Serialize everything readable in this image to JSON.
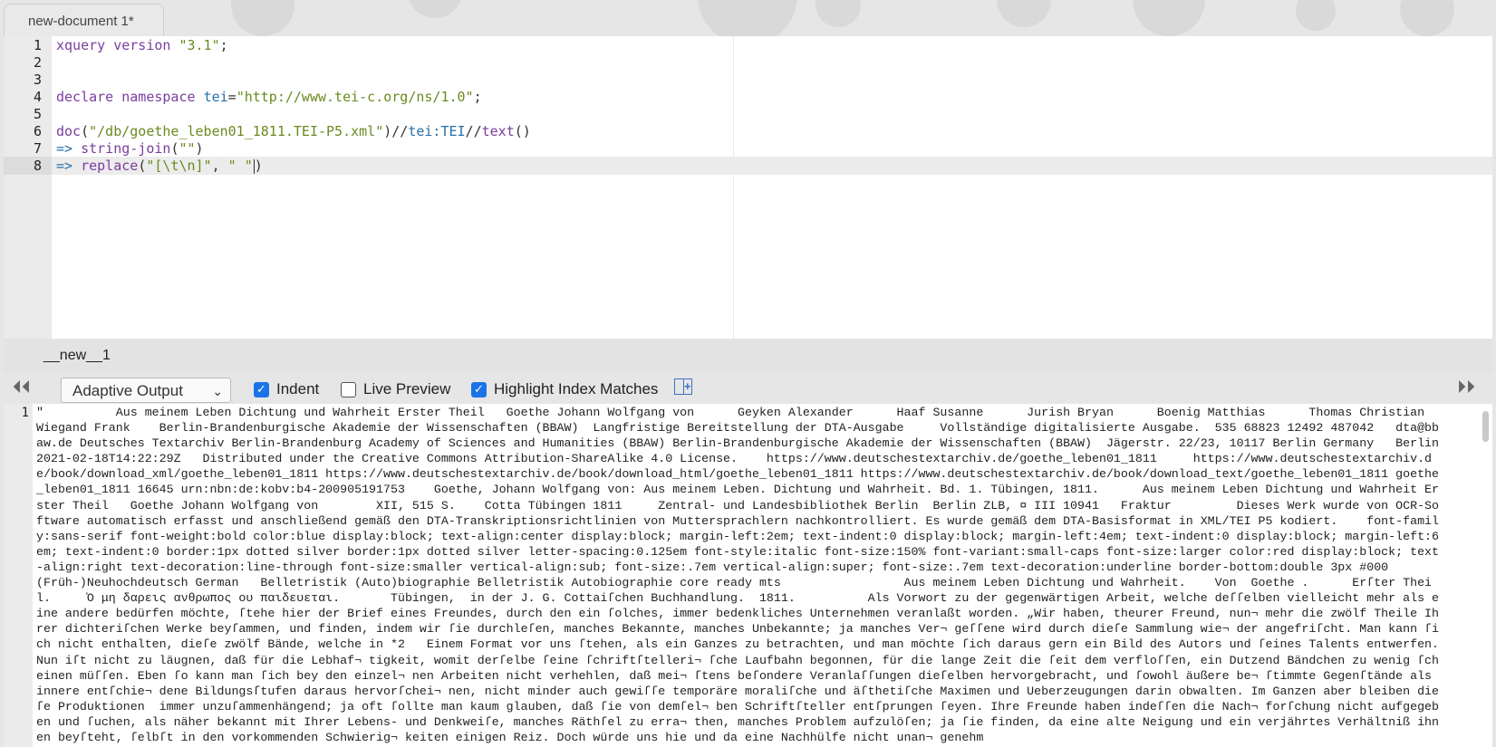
{
  "tab": {
    "title": "new-document 1*"
  },
  "editor": {
    "lines": [
      {
        "n": "1",
        "segments": [
          {
            "t": "xquery version ",
            "c": "kw"
          },
          {
            "t": "\"3.1\"",
            "c": "str"
          },
          {
            "t": ";",
            "c": ""
          }
        ]
      },
      {
        "n": "2",
        "segments": []
      },
      {
        "n": "3",
        "segments": []
      },
      {
        "n": "4",
        "segments": [
          {
            "t": "declare namespace ",
            "c": "kw"
          },
          {
            "t": "tei",
            "c": "ns"
          },
          {
            "t": "=",
            "c": ""
          },
          {
            "t": "\"http://www.tei-c.org/ns/1.0\"",
            "c": "str"
          },
          {
            "t": ";",
            "c": ""
          }
        ]
      },
      {
        "n": "5",
        "segments": []
      },
      {
        "n": "6",
        "segments": [
          {
            "t": "doc",
            "c": "fn"
          },
          {
            "t": "(",
            "c": ""
          },
          {
            "t": "\"/db/goethe_leben01_1811.TEI-P5.xml\"",
            "c": "str"
          },
          {
            "t": ")//",
            "c": ""
          },
          {
            "t": "tei:TEI",
            "c": "ns"
          },
          {
            "t": "//",
            "c": ""
          },
          {
            "t": "text",
            "c": "fn"
          },
          {
            "t": "()",
            "c": ""
          }
        ]
      },
      {
        "n": "7",
        "segments": [
          {
            "t": "=> ",
            "c": "op"
          },
          {
            "t": "string-join",
            "c": "fn"
          },
          {
            "t": "(",
            "c": ""
          },
          {
            "t": "\"\"",
            "c": "str"
          },
          {
            "t": ")",
            "c": ""
          }
        ]
      },
      {
        "n": "8",
        "segments": [
          {
            "t": "=> ",
            "c": "op"
          },
          {
            "t": "replace",
            "c": "fn"
          },
          {
            "t": "(",
            "c": ""
          },
          {
            "t": "\"[\\t\\n]\"",
            "c": "str"
          },
          {
            "t": ", ",
            "c": ""
          },
          {
            "t": "\" \"",
            "c": "str"
          },
          {
            "t": ")",
            "c": ""
          }
        ],
        "active": true
      }
    ]
  },
  "status": {
    "document_name": "__new__1"
  },
  "toolbar": {
    "output_mode": "Adaptive Output",
    "indent_label": "Indent",
    "live_preview_label": "Live Preview",
    "highlight_label": "Highlight Index Matches",
    "indent_checked": true,
    "live_preview_checked": false,
    "highlight_checked": true
  },
  "output": {
    "line_number": "1",
    "text": "\"          Aus meinem Leben Dichtung und Wahrheit Erster Theil   Goethe Johann Wolfgang von      Geyken Alexander      Haaf Susanne      Jurish Bryan      Boenig Matthias      Thomas Christian      Wiegand Frank    Berlin-Brandenburgische Akademie der Wissenschaften (BBAW)  Langfristige Bereitstellung der DTA-Ausgabe     Vollständige digitalisierte Ausgabe.  535 68823 12492 487042   dta@bbaw.de Deutsches Textarchiv Berlin-Brandenburg Academy of Sciences and Humanities (BBAW) Berlin-Brandenburgische Akademie der Wissenschaften (BBAW)  Jägerstr. 22/23, 10117 Berlin Germany   Berlin 2021-02-18T14:22:29Z   Distributed under the Creative Commons Attribution-ShareAlike 4.0 License.    https://www.deutschestextarchiv.de/goethe_leben01_1811     https://www.deutschestextarchiv.de/book/download_xml/goethe_leben01_1811 https://www.deutschestextarchiv.de/book/download_html/goethe_leben01_1811 https://www.deutschestextarchiv.de/book/download_text/goethe_leben01_1811 goethe_leben01_1811 16645 urn:nbn:de:kobv:b4-200905191753    Goethe, Johann Wolfgang von: Aus meinem Leben. Dichtung und Wahrheit. Bd. 1. Tübingen, 1811.      Aus meinem Leben Dichtung und Wahrheit Erster Theil   Goethe Johann Wolfgang von        XII, 515 S.    Cotta Tübingen 1811     Zentral- und Landesbibliothek Berlin  Berlin ZLB, ¤ III 10941   Fraktur         Dieses Werk wurde von OCR-Software automatisch erfasst und anschließend gemäß den DTA-Transkriptionsrichtlinien von Muttersprachlern nachkontrolliert. Es wurde gemäß dem DTA-Basisformat in XML/TEI P5 kodiert.    font-family:sans-serif font-weight:bold color:blue display:block; text-align:center display:block; margin-left:2em; text-indent:0 display:block; margin-left:4em; text-indent:0 display:block; margin-left:6em; text-indent:0 border:1px dotted silver border:1px dotted silver letter-spacing:0.125em font-style:italic font-size:150% font-variant:small-caps font-size:larger color:red display:block; text-align:right text-decoration:line-through font-size:smaller vertical-align:sub; font-size:.7em vertical-align:super; font-size:.7em text-decoration:underline border-bottom:double 3px #000      (Früh-)Neuhochdeutsch German   Belletristik (Auto)biographie Belletristik Autobiographie core ready mts                 Aus meinem Leben Dichtung und Wahrheit.    Von  Goethe .      Erſter Theil.     Ὁ μη δαρεις ανθρωπος ου παιδευεται.       Tübingen,  in der J. G. Cottaiſchen Buchhandlung.  1811.          Als Vorwort zu der gegenwärtigen Arbeit, welche deſſelben vielleicht mehr als eine andere bedürfen möchte, ſtehe hier der Brief eines Freundes, durch den ein ſolches, immer bedenkliches Unternehmen veranlaßt worden. „Wir haben, theurer Freund, nun¬ mehr die zwölf Theile Ihrer dichteriſchen Werke beyſammen, und finden, indem wir ſie durchleſen, manches Bekannte, manches Unbekannte; ja manches Ver¬ geſſene wird durch dieſe Sammlung wie¬ der angefriſcht. Man kann ſich nicht enthalten, dieſe zwölf Bände, welche in *2   Einem Format vor uns ſtehen, als ein Ganzes zu betrachten, und man möchte ſich daraus gern ein Bild des Autors und ſeines Talents entwerfen. Nun iſt nicht zu läugnen, daß für die Lebhaf¬ tigkeit, womit derſelbe ſeine ſchriftſtelleri¬ ſche Laufbahn begonnen, für die lange Zeit die ſeit dem verfloſſen, ein Dutzend Bändchen zu wenig ſcheinen müſſen. Eben ſo kann man ſich bey den einzel¬ nen Arbeiten nicht verhehlen, daß mei¬ ſtens beſondere Veranlaſſungen dieſelben hervorgebracht, und ſowohl äußere be¬ ſtimmte Gegenſtände als innere entſchie¬ dene Bildungsſtufen daraus hervorſchei¬ nen, nicht minder auch gewiſſe temporäre moraliſche und äſthetiſche Maximen und Ueberzeugungen darin obwalten. Im Ganzen aber bleiben dieſe Produktionen  immer unzuſammenhängend; ja oft ſollte man kaum glauben, daß ſie von demſel¬ ben Schriftſteller entſprungen ſeyen. Ihre Freunde haben indeſſen die Nach¬ forſchung nicht aufgegeben und ſuchen, als näher bekannt mit Ihrer Lebens- und Denkweiſe, manches Räthſel zu erra¬ then, manches Problem aufzulöſen; ja ſie finden, da eine alte Neigung und ein verjährtes Verhältniß ihnen beyſteht, ſelbſt in den vorkommenden Schwierig¬ keiten einigen Reiz. Doch würde uns hie und da eine Nachhülfe nicht unan¬ genehm"
  }
}
